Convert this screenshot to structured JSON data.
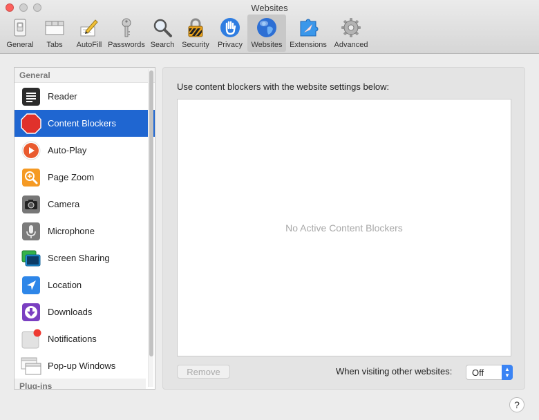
{
  "window": {
    "title": "Websites"
  },
  "toolbar": {
    "items": [
      {
        "label": "General",
        "icon": "general-switch-icon"
      },
      {
        "label": "Tabs",
        "icon": "tabs-icon"
      },
      {
        "label": "AutoFill",
        "icon": "autofill-pencil-icon"
      },
      {
        "label": "Passwords",
        "icon": "key-icon"
      },
      {
        "label": "Search",
        "icon": "magnifier-icon"
      },
      {
        "label": "Security",
        "icon": "padlock-icon"
      },
      {
        "label": "Privacy",
        "icon": "hand-icon"
      },
      {
        "label": "Websites",
        "icon": "globe-icon",
        "selected": true
      },
      {
        "label": "Extensions",
        "icon": "puzzle-compass-icon"
      },
      {
        "label": "Advanced",
        "icon": "gear-icon"
      }
    ]
  },
  "sidebar": {
    "header_general": "General",
    "header_plugins": "Plug-ins",
    "items": [
      {
        "label": "Reader",
        "icon": "reader-icon"
      },
      {
        "label": "Content Blockers",
        "icon": "stop-sign-icon",
        "selected": true
      },
      {
        "label": "Auto-Play",
        "icon": "play-icon"
      },
      {
        "label": "Page Zoom",
        "icon": "zoom-icon"
      },
      {
        "label": "Camera",
        "icon": "camera-icon"
      },
      {
        "label": "Microphone",
        "icon": "microphone-icon"
      },
      {
        "label": "Screen Sharing",
        "icon": "screen-sharing-icon"
      },
      {
        "label": "Location",
        "icon": "location-arrow-icon"
      },
      {
        "label": "Downloads",
        "icon": "download-icon"
      },
      {
        "label": "Notifications",
        "icon": "notifications-icon"
      },
      {
        "label": "Pop-up Windows",
        "icon": "popup-windows-icon"
      }
    ]
  },
  "panel": {
    "heading": "Use content blockers with the website settings below:",
    "empty_text": "No Active Content Blockers",
    "remove_label": "Remove",
    "other_websites_label": "When visiting other websites:",
    "other_websites_value": "Off"
  },
  "help": {
    "label": "?"
  },
  "colors": {
    "accent": "#1f66d1",
    "close": "#fc605c",
    "select_arrow": "#3b84f4"
  }
}
